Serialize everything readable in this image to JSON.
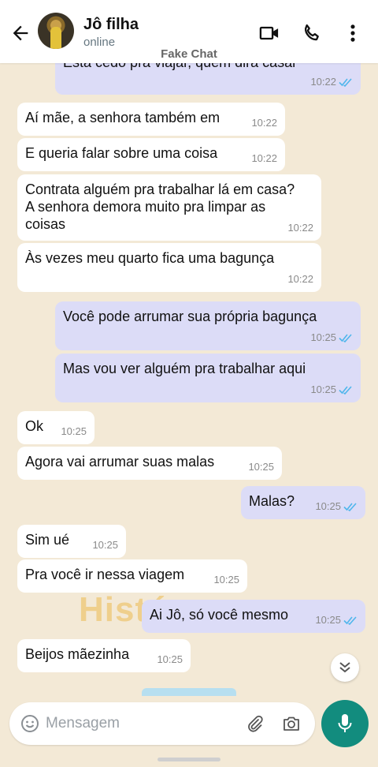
{
  "header": {
    "contact_name": "Jô filha",
    "status": "online",
    "overlay_label": "Fake Chat"
  },
  "icons": {
    "back": "arrow-left-icon",
    "video": "video-camera-icon",
    "call": "phone-icon",
    "menu": "more-vertical-icon",
    "emoji": "emoji-icon",
    "attach": "paperclip-icon",
    "camera": "camera-icon",
    "mic": "microphone-icon",
    "scroll": "chevron-double-down-icon"
  },
  "colors": {
    "outgoing_bubble": "#dcdcf7",
    "incoming_bubble": "#ffffff",
    "chat_background": "#f3e9d6",
    "read_ticks": "#4fb6ec",
    "mic_button": "#128c7e"
  },
  "background_text": "Histó",
  "messages": [
    {
      "dir": "out",
      "text": "Está cedo pra viajar, quem dirá casar",
      "time": "10:22",
      "read": true
    },
    {
      "dir": "in",
      "text": "Aí mãe, a senhora também em",
      "time": "10:22"
    },
    {
      "dir": "in",
      "text": "E queria falar sobre uma coisa",
      "time": "10:22"
    },
    {
      "dir": "in",
      "text": "Contrata alguém pra trabalhar lá em casa? A senhora demora muito pra limpar as coisas",
      "time": "10:22"
    },
    {
      "dir": "in",
      "text": "Às vezes meu quarto fica uma bagunça",
      "time": "10:22"
    },
    {
      "dir": "out",
      "text": "Você pode arrumar sua própria bagunça",
      "time": "10:25",
      "read": true
    },
    {
      "dir": "out",
      "text": "Mas vou ver alguém pra trabalhar aqui",
      "time": "10:25",
      "read": true
    },
    {
      "dir": "in",
      "text": "Ok",
      "time": "10:25"
    },
    {
      "dir": "in",
      "text": "Agora vai arrumar suas malas",
      "time": "10:25"
    },
    {
      "dir": "out",
      "text": "Malas?",
      "time": "10:25",
      "read": true
    },
    {
      "dir": "in",
      "text": "Sim ué",
      "time": "10:25"
    },
    {
      "dir": "in",
      "text": "Pra você ir nessa viagem",
      "time": "10:25"
    },
    {
      "dir": "out",
      "text": "Ai Jô, só você mesmo",
      "time": "10:25",
      "read": true
    },
    {
      "dir": "in",
      "text": "Beijos mãezinha",
      "time": "10:25"
    }
  ],
  "composer": {
    "placeholder": "Mensagem"
  }
}
